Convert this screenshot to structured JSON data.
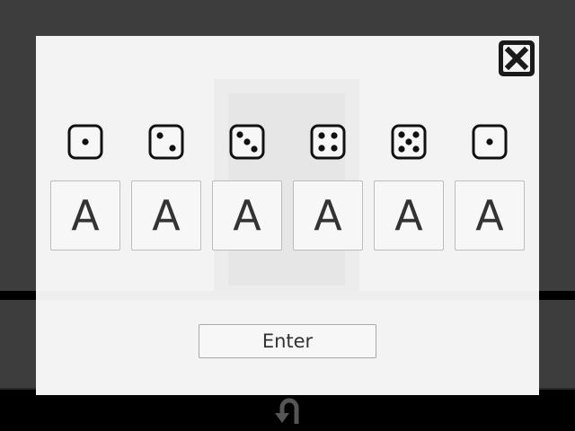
{
  "dialog": {
    "dice": [
      {
        "icon": "die-face-1-icon",
        "pips": 1
      },
      {
        "icon": "die-face-2-icon",
        "pips": 2
      },
      {
        "icon": "die-face-3-icon",
        "pips": 3
      },
      {
        "icon": "die-face-4-icon",
        "pips": 4
      },
      {
        "icon": "die-face-5-icon",
        "pips": 5
      },
      {
        "icon": "die-face-1-icon",
        "pips": 1
      }
    ],
    "letters": [
      "A",
      "A",
      "A",
      "A",
      "A",
      "A"
    ],
    "enter_label": "Enter",
    "close_icon": "close-icon"
  },
  "footer": {
    "back_icon": "return-arrow-icon"
  },
  "colors": {
    "background": "#3d3d3d",
    "dialog": "#f3f3f3",
    "bar": "#000000"
  }
}
